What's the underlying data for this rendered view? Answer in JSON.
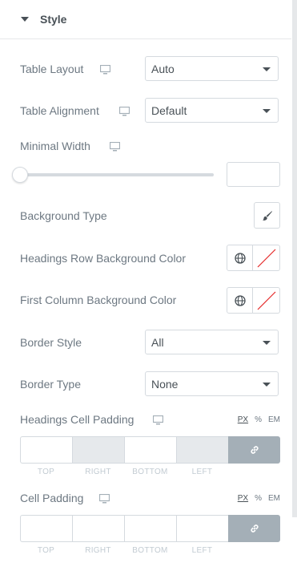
{
  "section": {
    "title": "Style"
  },
  "table_layout": {
    "label": "Table Layout",
    "value": "Auto"
  },
  "table_alignment": {
    "label": "Table Alignment",
    "value": "Default"
  },
  "minimal_width": {
    "label": "Minimal Width",
    "value": "",
    "slider_fraction": 0
  },
  "background_type": {
    "label": "Background Type"
  },
  "headings_row_bg": {
    "label": "Headings Row Background Color"
  },
  "first_column_bg": {
    "label": "First Column Background Color"
  },
  "border_style": {
    "label": "Border Style",
    "value": "All"
  },
  "border_type": {
    "label": "Border Type",
    "value": "None"
  },
  "headings_cell_padding": {
    "label": "Headings Cell Padding",
    "units": [
      "PX",
      "%",
      "EM"
    ],
    "sides": [
      "TOP",
      "RIGHT",
      "BOTTOM",
      "LEFT"
    ]
  },
  "cell_padding": {
    "label": "Cell Padding",
    "units": [
      "PX",
      "%",
      "EM"
    ],
    "sides": [
      "TOP",
      "RIGHT",
      "BOTTOM",
      "LEFT"
    ]
  },
  "icons": [
    "caret-down-icon",
    "monitor-icon",
    "brush-icon",
    "globe-icon",
    "no-color-icon",
    "link-icon"
  ],
  "colors": {
    "text": "#6d7882",
    "dark": "#495157",
    "border": "#d5dadf",
    "link_bg": "#a4afb7",
    "no_color": "#e52b2b"
  }
}
